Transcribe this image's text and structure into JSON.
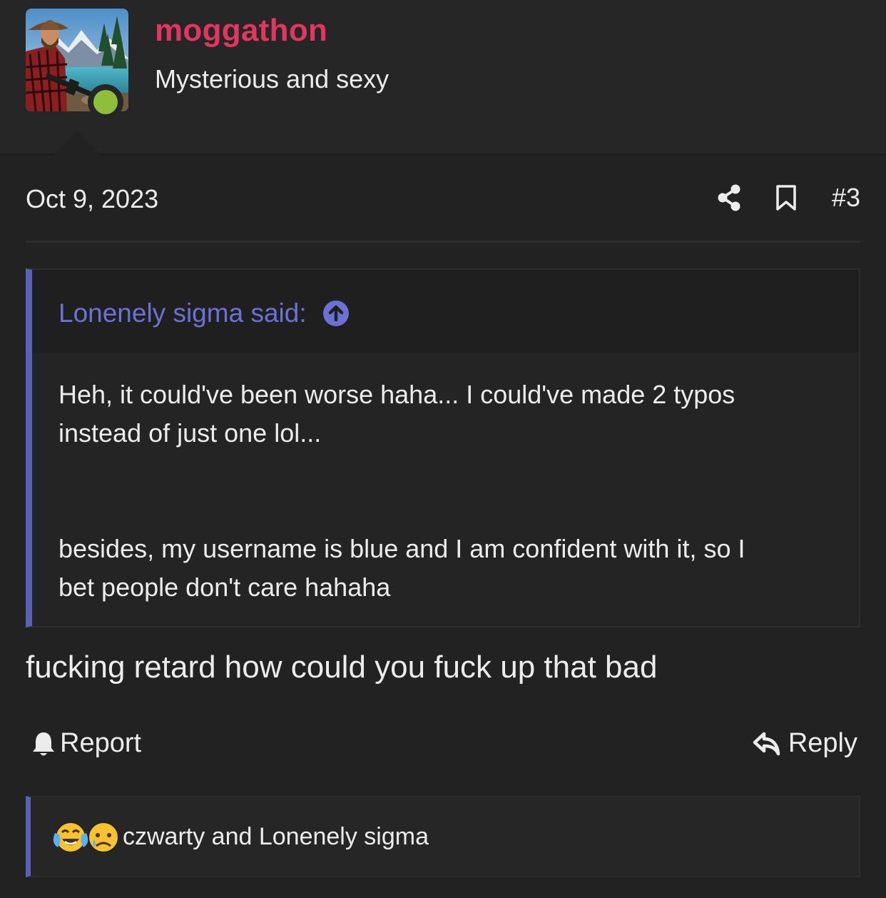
{
  "user": {
    "name": "moggathon",
    "title": "Mysterious and sexy",
    "online": true,
    "avatar_icon": "avatar-image",
    "accent_color": "#e0365f"
  },
  "post": {
    "date": "Oct 9, 2023",
    "number": "#3",
    "share_icon": "share-icon",
    "bookmark_icon": "bookmark-icon"
  },
  "quote": {
    "author_label": "Lonenely sigma said:",
    "expand_icon": "arrow-up-circle-icon",
    "lines": [
      "Heh, it could've been worse haha... I could've made 2 typos",
      "instead of just one lol...",
      "besides, my username is blue and I am confident with it, so I",
      "bet people don't care hahaha"
    ],
    "accent_color": "#5a62b8"
  },
  "message": {
    "text": "fucking retard how could you fuck up that bad"
  },
  "actions": {
    "report_label": "Report",
    "reply_label": "Reply"
  },
  "reactions": {
    "emojis": [
      "crying-laughing-emoji",
      "sad-face-emoji"
    ],
    "users_text": "czwarty and Lonenely sigma"
  }
}
